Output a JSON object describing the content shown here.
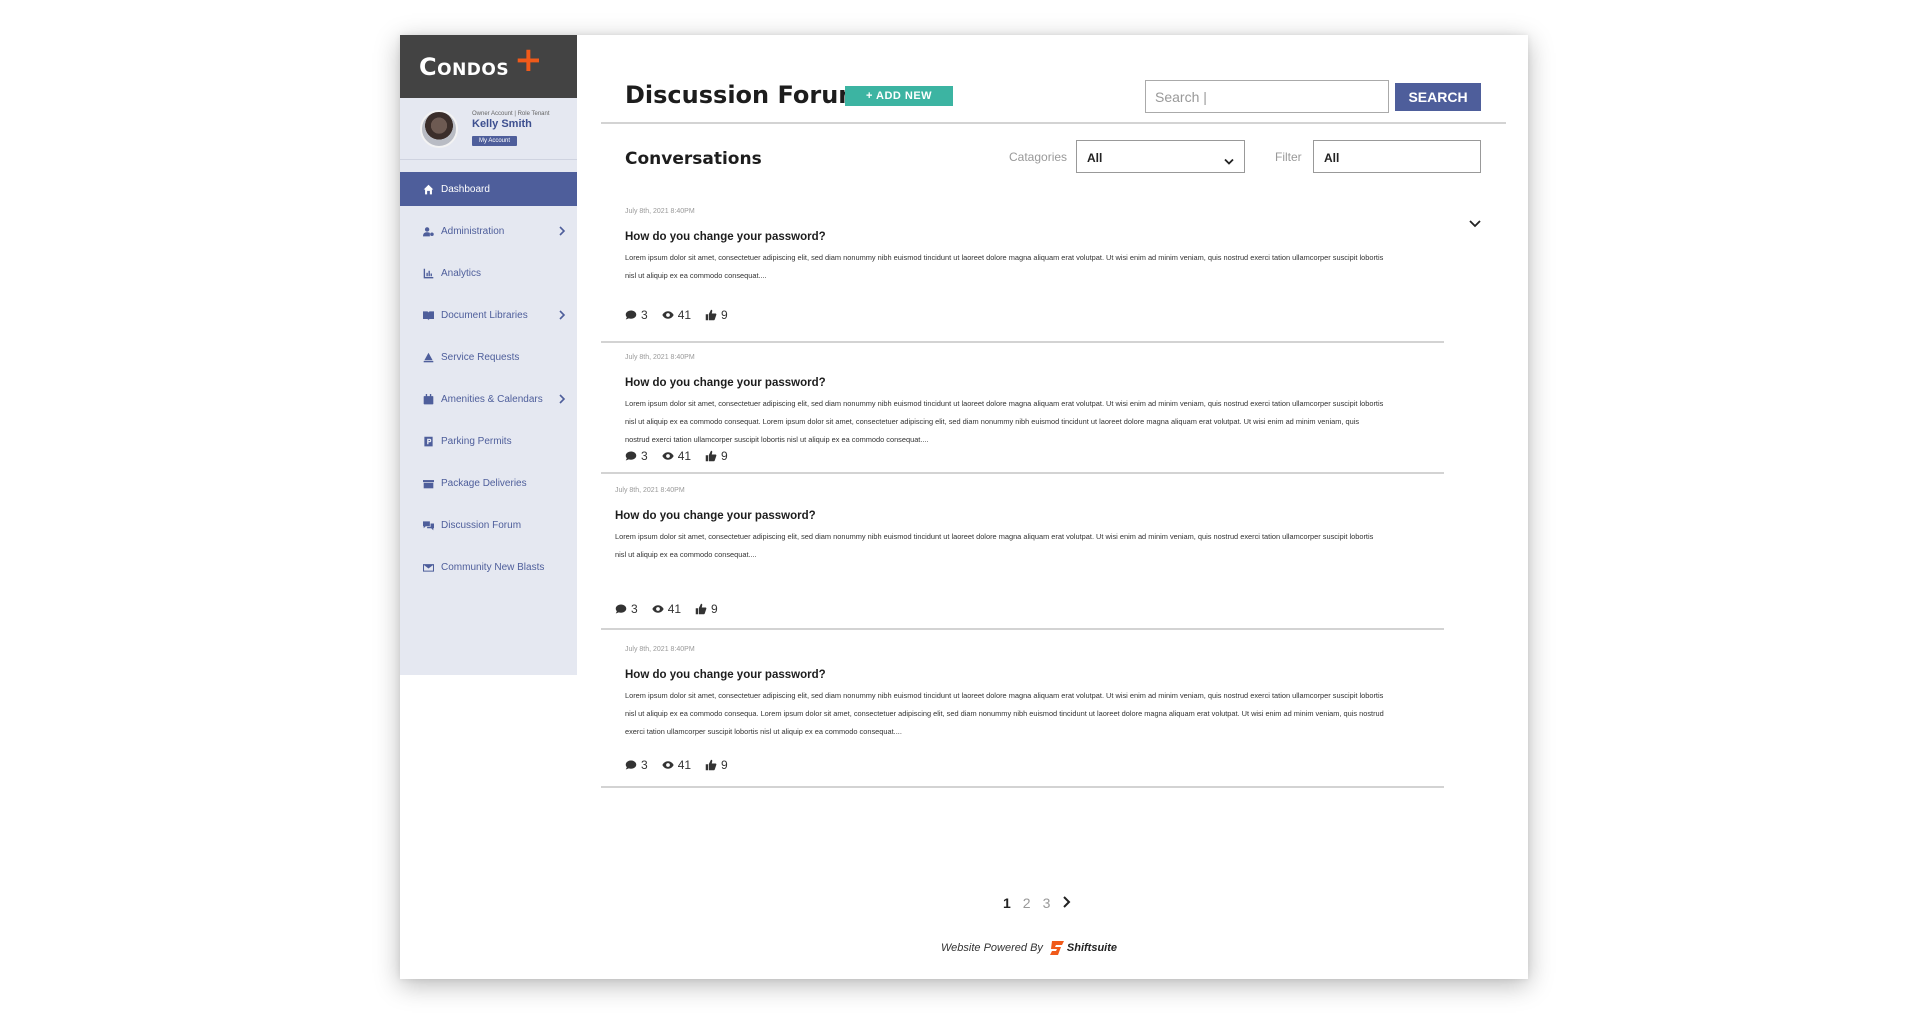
{
  "brand": {
    "name": "Condos",
    "plus": "+",
    "accent": "#f05a1a"
  },
  "profile": {
    "role": "Owner Account | Role Tenant",
    "name": "Kelly Smith",
    "account_label": "My Account"
  },
  "sidebar": {
    "items": [
      {
        "label": "Dashboard",
        "icon": "home-icon",
        "active": true,
        "has_children": false
      },
      {
        "label": "Administration",
        "icon": "user-cog-icon",
        "active": false,
        "has_children": true
      },
      {
        "label": "Analytics",
        "icon": "chart-icon",
        "active": false,
        "has_children": false
      },
      {
        "label": "Document Libraries",
        "icon": "book-icon",
        "active": false,
        "has_children": true
      },
      {
        "label": "Service Requests",
        "icon": "bell-icon",
        "active": false,
        "has_children": false
      },
      {
        "label": "Amenities & Calendars",
        "icon": "calendar-icon",
        "active": false,
        "has_children": true
      },
      {
        "label": "Parking Permits",
        "icon": "parking-icon",
        "active": false,
        "has_children": false
      },
      {
        "label": "Package Deliveries",
        "icon": "package-icon",
        "active": false,
        "has_children": false
      },
      {
        "label": "Discussion Forum",
        "icon": "comments-icon",
        "active": false,
        "has_children": false
      },
      {
        "label": "Community New Blasts",
        "icon": "envelope-icon",
        "active": false,
        "has_children": false
      }
    ]
  },
  "header": {
    "title": "Discussion Forum",
    "add_new_label": "+ ADD NEW",
    "search_placeholder": "Search |",
    "search_button": "SEARCH"
  },
  "conversations": {
    "title": "Conversations",
    "categories_label": "Catagories",
    "categories_value": "All",
    "filter_label": "Filter",
    "filter_value": "All"
  },
  "posts": [
    {
      "date": "July 8th, 2021 8:40PM",
      "title": "How do you change your password?",
      "body": "Lorem ipsum dolor sit amet, consectetuer adipiscing elit, sed diam nonummy nibh euismod tincidunt ut laoreet dolore magna aliquam erat volutpat. Ut wisi enim ad minim veniam, quis nostrud exerci tation ullamcorper suscipit lobortis nisl ut aliquip ex ea commodo consequat....",
      "comments": "3",
      "views": "41",
      "likes": "9"
    },
    {
      "date": "July 8th, 2021 8:40PM",
      "title": "How do you change your password?",
      "body": "Lorem ipsum dolor sit amet, consectetuer adipiscing elit, sed diam nonummy nibh euismod tincidunt ut laoreet dolore magna aliquam erat volutpat. Ut wisi enim ad minim veniam, quis nostrud exerci tation ullamcorper suscipit lobortis nisl ut aliquip ex ea commodo consequat. Lorem ipsum dolor sit amet, consectetuer adipiscing elit, sed diam nonummy nibh euismod tincidunt ut laoreet dolore magna aliquam erat volutpat. Ut wisi enim ad minim veniam, quis nostrud exerci tation ullamcorper suscipit lobortis nisl ut aliquip ex ea commodo consequat....",
      "comments": "3",
      "views": "41",
      "likes": "9"
    },
    {
      "date": "July 8th, 2021 8:40PM",
      "title": "How do you change your password?",
      "body": "Lorem ipsum dolor sit amet, consectetuer adipiscing elit, sed diam nonummy nibh euismod tincidunt ut laoreet dolore magna aliquam erat volutpat. Ut wisi enim ad minim veniam, quis nostrud exerci tation ullamcorper suscipit lobortis nisl ut aliquip ex ea commodo consequat....",
      "comments": "3",
      "views": "41",
      "likes": "9"
    },
    {
      "date": "July 8th, 2021 8:40PM",
      "title": "How do you change your password?",
      "body": "Lorem ipsum dolor sit amet, consectetuer adipiscing elit, sed diam nonummy nibh euismod tincidunt ut laoreet dolore magna aliquam erat volutpat. Ut wisi enim ad minim veniam, quis nostrud exerci tation ullamcorper suscipit lobortis nisl ut aliquip ex ea commodo consequa. Lorem ipsum dolor sit amet, consectetuer adipiscing elit, sed diam nonummy nibh euismod tincidunt ut laoreet dolore magna aliquam erat volutpat. Ut wisi enim ad minim veniam, quis nostrud exerci tation ullamcorper suscipit lobortis nisl ut aliquip ex ea commodo consequat....",
      "comments": "3",
      "views": "41",
      "likes": "9"
    }
  ],
  "pagination": {
    "pages": [
      "1",
      "2",
      "3"
    ],
    "current": "1"
  },
  "footer": {
    "powered_by": "Website Powered By",
    "brand": "Shiftsuite"
  },
  "colors": {
    "primary": "#4e5e9b",
    "teal": "#3cb4a2",
    "sidebar_bg": "#e5e8f1",
    "logo_bg": "#434343"
  }
}
